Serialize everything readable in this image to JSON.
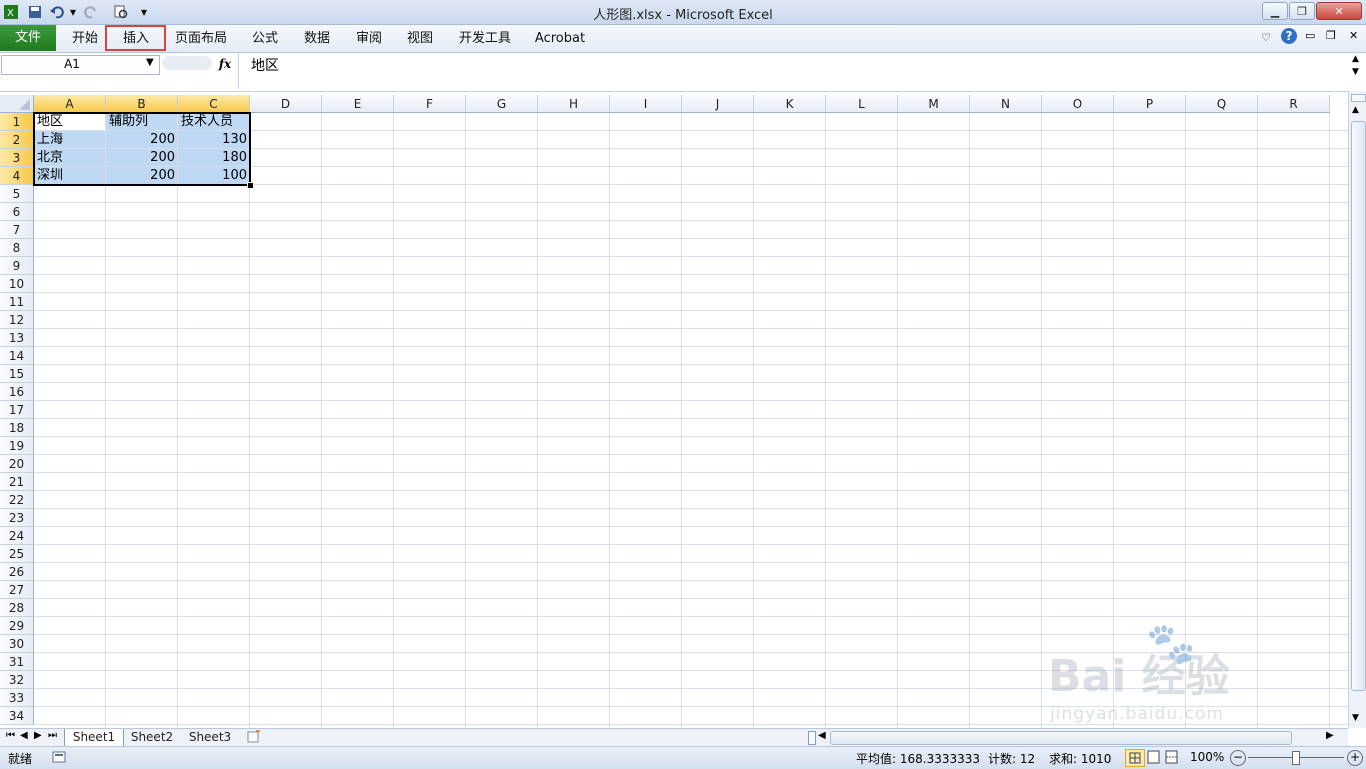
{
  "window": {
    "title": "人形图.xlsx - Microsoft Excel"
  },
  "ribbon": {
    "file_tab": "文件",
    "tabs": [
      "开始",
      "插入",
      "页面布局",
      "公式",
      "数据",
      "审阅",
      "视图",
      "开发工具",
      "Acrobat"
    ],
    "highlighted_tab": "插入"
  },
  "formula_bar": {
    "name_box": "A1",
    "fx_label": "fx",
    "formula": "地区"
  },
  "grid": {
    "columns": [
      "A",
      "B",
      "C",
      "D",
      "E",
      "F",
      "G",
      "H",
      "I",
      "J",
      "K",
      "L",
      "M",
      "N",
      "O",
      "P",
      "Q",
      "R"
    ],
    "rows": [
      "1",
      "2",
      "3",
      "4",
      "5",
      "6",
      "7",
      "8",
      "9",
      "10",
      "11",
      "12",
      "13",
      "14",
      "15",
      "16",
      "17",
      "18",
      "19",
      "20",
      "21",
      "22",
      "23",
      "24",
      "25",
      "26",
      "27",
      "28",
      "29",
      "30",
      "31",
      "32",
      "33",
      "34"
    ],
    "data": [
      [
        "地区",
        "辅助列",
        "技术人员"
      ],
      [
        "上海",
        "200",
        "130"
      ],
      [
        "北京",
        "200",
        "180"
      ],
      [
        "深圳",
        "200",
        "100"
      ]
    ]
  },
  "sheets": [
    "Sheet1",
    "Sheet2",
    "Sheet3"
  ],
  "status": {
    "ready": "就绪",
    "average": "平均值: 168.3333333",
    "count": "计数: 12",
    "sum": "求和: 1010",
    "zoom": "100%"
  },
  "watermark": {
    "brand": "Bai 经验",
    "url": "jingyan.baidu.com"
  },
  "colors": {
    "file_tab": "#217a21",
    "selection": "#bfd8f4",
    "header_selected": "#f7c94a",
    "highlight_box": "#e0403a"
  }
}
